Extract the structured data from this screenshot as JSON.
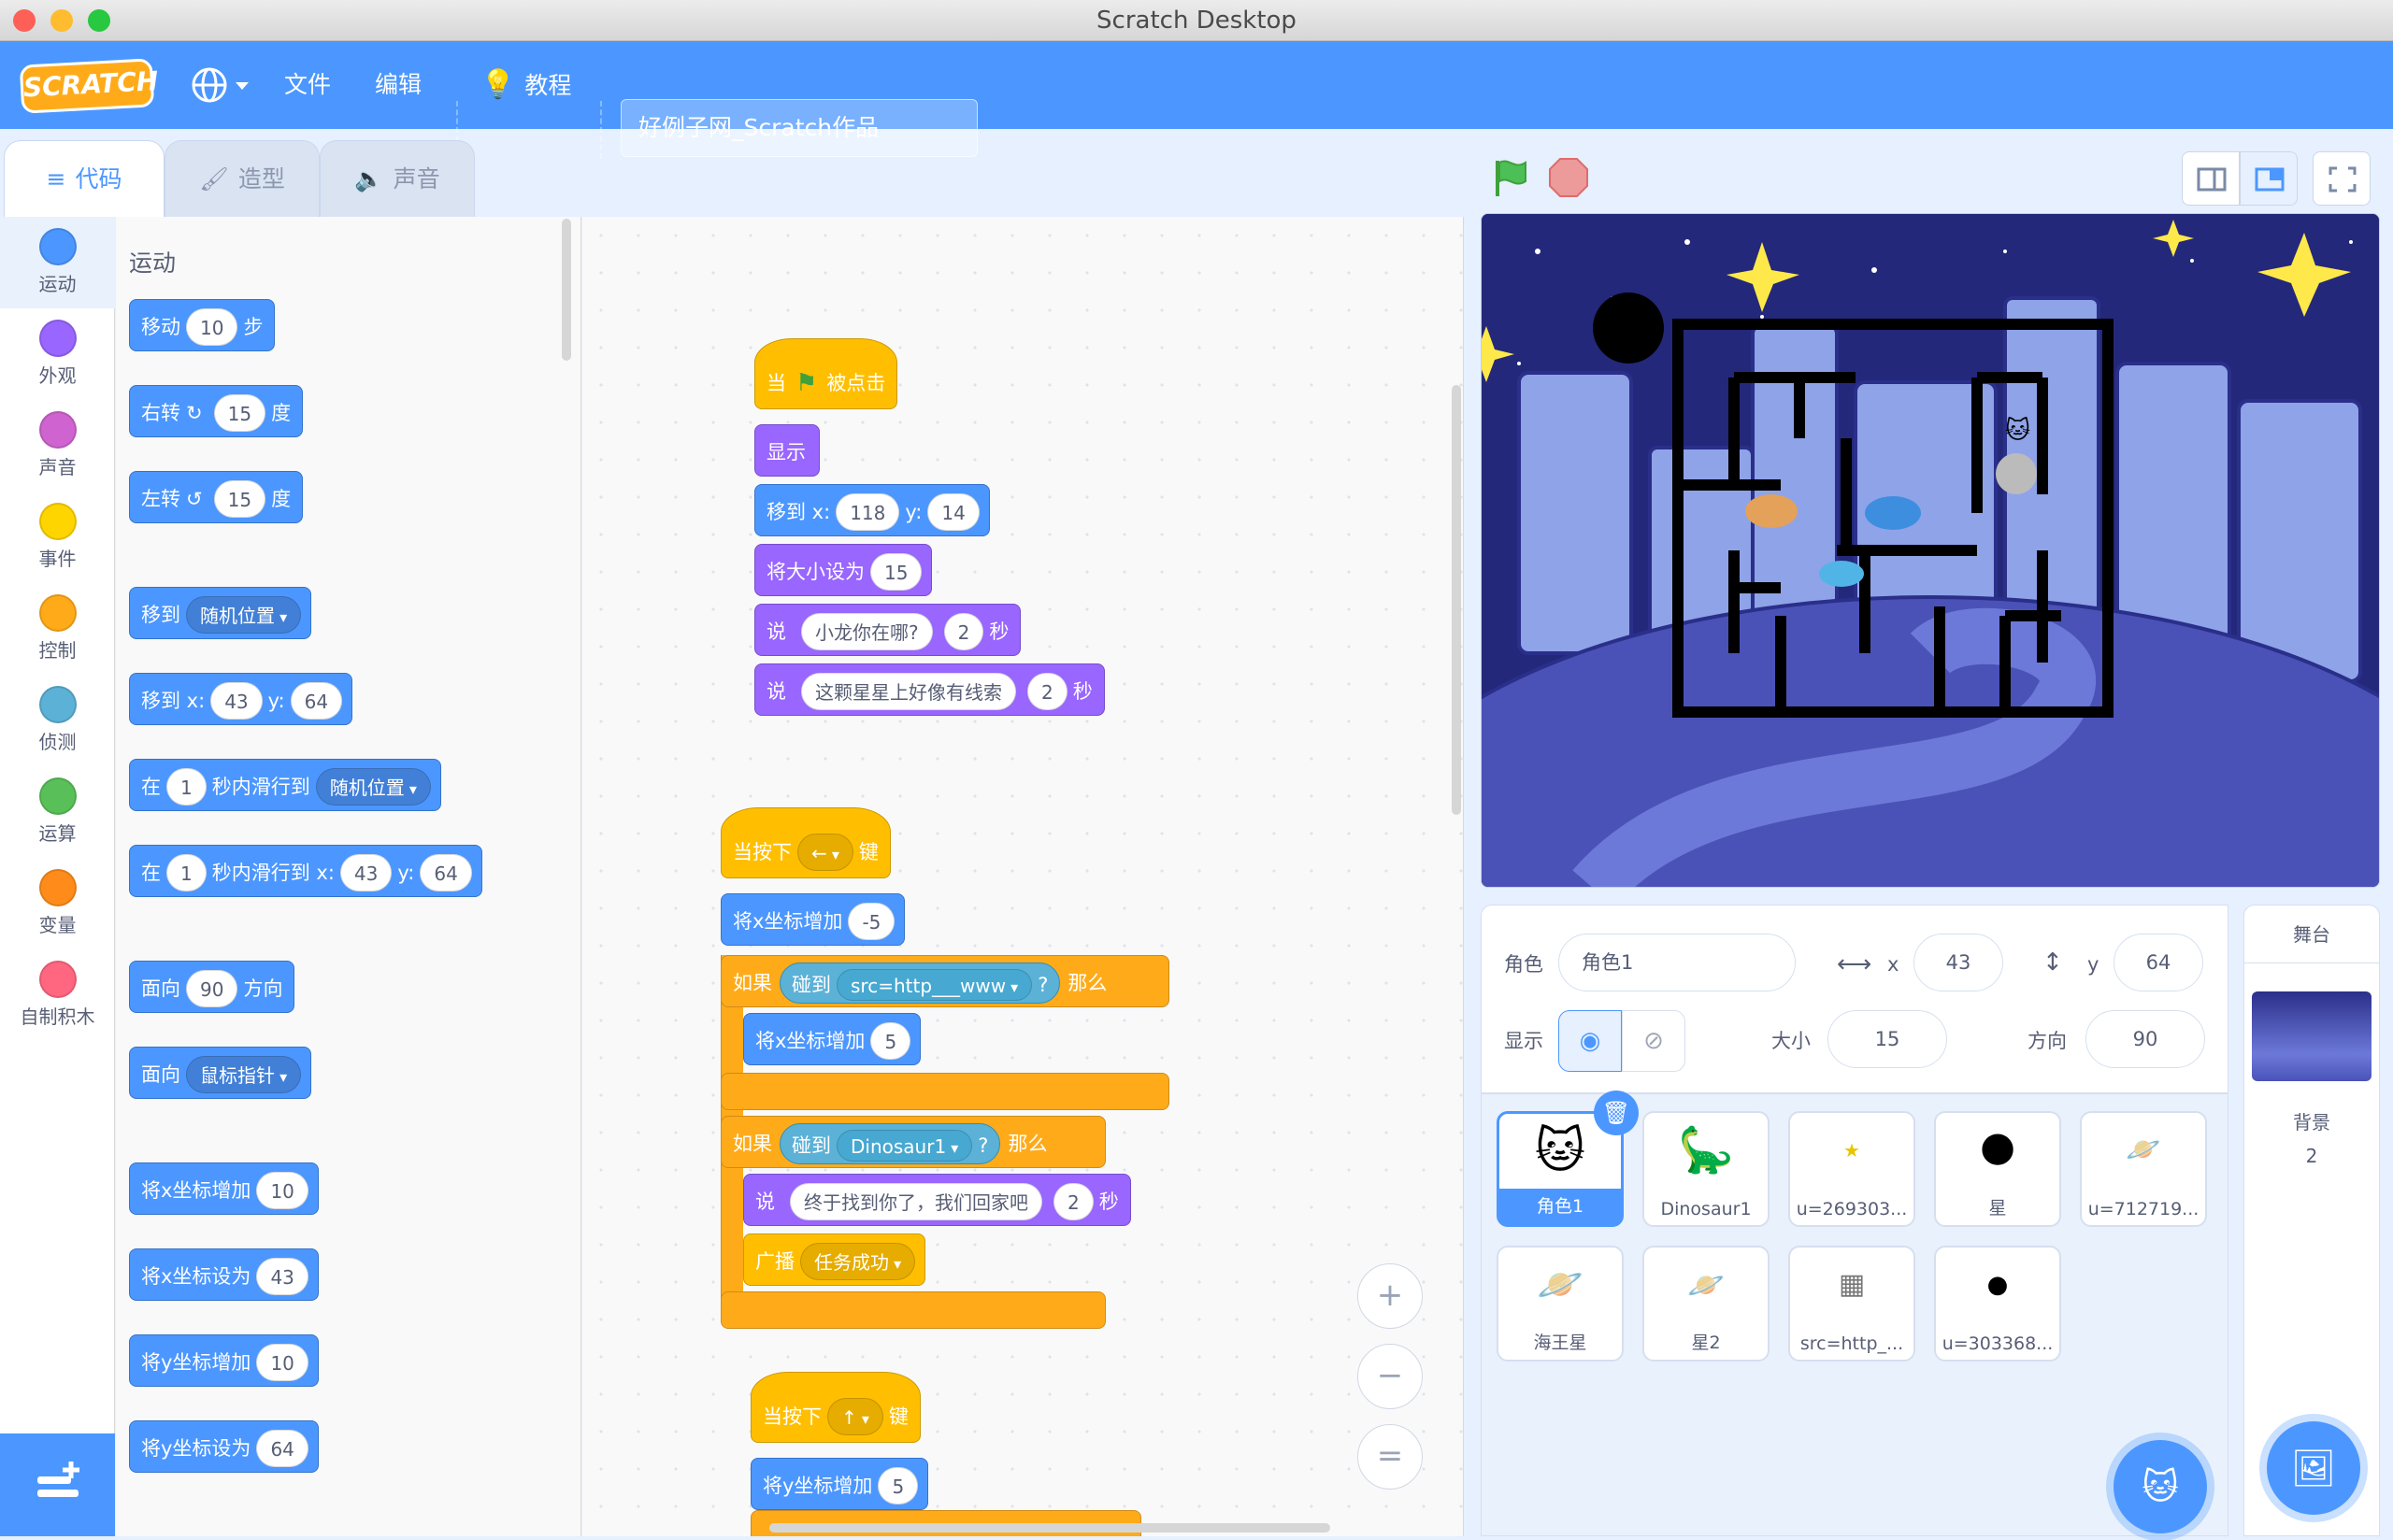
{
  "window": {
    "title": "Scratch Desktop"
  },
  "menubar": {
    "logo": "SCRATCH",
    "file": "文件",
    "edit": "编辑",
    "tutorials": "教程",
    "project_title": "好例子网_Scratch作品"
  },
  "tabs": [
    {
      "label": "代码",
      "icon": "code-icon",
      "active": true
    },
    {
      "label": "造型",
      "icon": "brush-icon",
      "active": false
    },
    {
      "label": "声音",
      "icon": "speaker-icon",
      "active": false
    }
  ],
  "categories": [
    {
      "label": "运动",
      "color": "#4c97ff"
    },
    {
      "label": "外观",
      "color": "#9966ff"
    },
    {
      "label": "声音",
      "color": "#cf63cf"
    },
    {
      "label": "事件",
      "color": "#ffd500"
    },
    {
      "label": "控制",
      "color": "#ffab19"
    },
    {
      "label": "侦测",
      "color": "#5cb1d6"
    },
    {
      "label": "运算",
      "color": "#59c059"
    },
    {
      "label": "变量",
      "color": "#ff8c1a"
    },
    {
      "label": "自制积木",
      "color": "#ff6680"
    }
  ],
  "palette": {
    "section": "运动",
    "move": {
      "a": "移动",
      "v": "10",
      "b": "步"
    },
    "turn_right": {
      "a": "右转",
      "v": "15",
      "b": "度"
    },
    "turn_left": {
      "a": "左转",
      "v": "15",
      "b": "度"
    },
    "goto": {
      "a": "移到",
      "dd": "随机位置"
    },
    "goto_xy": {
      "a": "移到 x:",
      "x": "43",
      "b": "y:",
      "y": "64"
    },
    "glide": {
      "a": "在",
      "v": "1",
      "b": "秒内滑行到",
      "dd": "随机位置"
    },
    "glide_xy": {
      "a": "在",
      "v": "1",
      "b": "秒内滑行到 x:",
      "x": "43",
      "c": "y:",
      "y": "64"
    },
    "point_dir": {
      "a": "面向",
      "v": "90",
      "b": "方向"
    },
    "point_towards": {
      "a": "面向",
      "dd": "鼠标指针"
    },
    "change_x": {
      "a": "将x坐标增加",
      "v": "10"
    },
    "set_x": {
      "a": "将x坐标设为",
      "v": "43"
    },
    "change_y": {
      "a": "将y坐标增加",
      "v": "10"
    },
    "set_y": {
      "a": "将y坐标设为",
      "v": "64"
    }
  },
  "script1": {
    "hat": {
      "a": "当",
      "b": "被点击"
    },
    "show": "显示",
    "goto": {
      "a": "移到 x:",
      "x": "118",
      "b": "y:",
      "y": "14"
    },
    "size": {
      "a": "将大小设为",
      "v": "15"
    },
    "say1": {
      "a": "说",
      "text": "小龙你在哪?",
      "secs": "2",
      "b": "秒"
    },
    "say2": {
      "a": "说",
      "text": "这颗星星上好像有线索",
      "secs": "2",
      "b": "秒"
    }
  },
  "script2": {
    "hat": {
      "a": "当按下",
      "dd": "←",
      "b": "键"
    },
    "change_x": {
      "a": "将x坐标增加",
      "v": "-5"
    },
    "if1": {
      "a": "如果",
      "touch": "碰到",
      "dd": "src=http___www",
      "q": "?",
      "then": "那么"
    },
    "change_x2": {
      "a": "将x坐标增加",
      "v": "5"
    },
    "if2": {
      "a": "如果",
      "touch": "碰到",
      "dd": "Dinosaur1",
      "q": "?",
      "then": "那么"
    },
    "say": {
      "a": "说",
      "text": "终于找到你了，我们回家吧",
      "secs": "2",
      "b": "秒"
    },
    "broadcast": {
      "a": "广播",
      "dd": "任务成功"
    }
  },
  "script3": {
    "hat": {
      "a": "当按下",
      "dd": "↑",
      "b": "键"
    },
    "change_y": {
      "a": "将y坐标增加",
      "v": "5"
    }
  },
  "zoom": {
    "in": "+",
    "out": "−",
    "reset": "="
  },
  "sprite_info": {
    "sprite_label": "角色",
    "sprite_name": "角色1",
    "x_label": "x",
    "x": "43",
    "y_label": "y",
    "y": "64",
    "show_label": "显示",
    "size_label": "大小",
    "size": "15",
    "direction_label": "方向",
    "direction": "90"
  },
  "sprites": [
    {
      "name": "角色1",
      "selected": true,
      "thumb": "🐱"
    },
    {
      "name": "Dinosaur1",
      "selected": false,
      "thumb": "🦕"
    },
    {
      "name": "u=269303...",
      "selected": false,
      "thumb": "★"
    },
    {
      "name": "星",
      "selected": false,
      "thumb": "🌑"
    },
    {
      "name": "u=712719...",
      "selected": false,
      "thumb": "🪐"
    },
    {
      "name": "海王星",
      "selected": false,
      "thumb": "🪐"
    },
    {
      "name": "星2",
      "selected": false,
      "thumb": "🪐"
    },
    {
      "name": "src=http_...",
      "selected": false,
      "thumb": "▦"
    },
    {
      "name": "u=303368...",
      "selected": false,
      "thumb": "●"
    }
  ],
  "stage_pane": {
    "title": "舞台",
    "backdrop_label": "背景",
    "backdrop_count": "2"
  },
  "colors": {
    "motion": "#4c97ff",
    "looks": "#9966ff",
    "events": "#ffbf00",
    "control": "#ffab19",
    "sensing": "#5cb1d6",
    "accent": "#4c97ff"
  }
}
